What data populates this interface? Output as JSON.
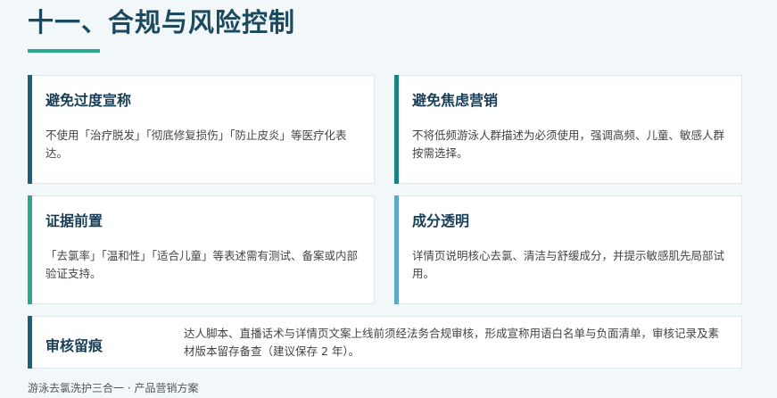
{
  "title": "十一、合规与风险控制",
  "colors": {
    "title": "#1b4a5e",
    "underline": "#2aa889",
    "bar_dark_blue": "#1e5f7a",
    "bar_teal": "#1a8187",
    "bar_green": "#2aa889",
    "bar_light_blue": "#5aa9c6"
  },
  "cards": [
    {
      "heading": "避免过度宣称",
      "body": "不使用「治疗脱发」「彻底修复损伤」「防止皮炎」等医疗化表达。"
    },
    {
      "heading": "避免焦虑营销",
      "body": "不将低频游泳人群描述为必须使用，强调高频、儿童、敏感人群按需选择。"
    },
    {
      "heading": "证据前置",
      "body": "「去氯率」「温和性」「适合儿童」等表述需有测试、备案或内部验证支持。"
    },
    {
      "heading": "成分透明",
      "body": "详情页说明核心去氯、清洁与舒缓成分，并提示敏感肌先局部试用。"
    }
  ],
  "audit": {
    "heading": "审核留痕",
    "body": "达人脚本、直播话术与详情页文案上线前须经法务合规审核，形成宣称用语白名单与负面清单，审核记录及素材版本留存备查（建议保存 2 年）。"
  },
  "footer": "游泳去氯洗护三合一 · 产品营销方案"
}
